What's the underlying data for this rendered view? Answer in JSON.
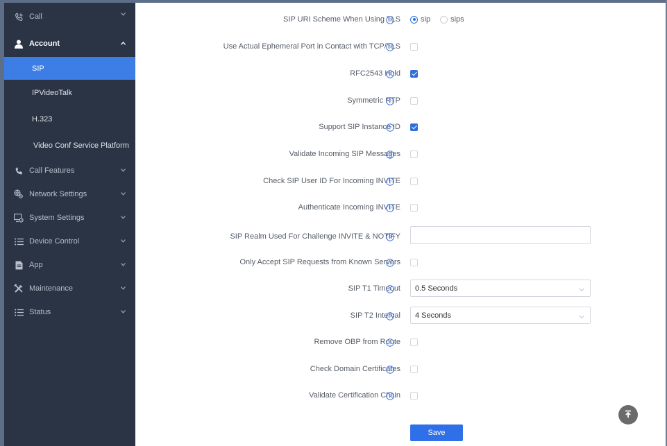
{
  "sidebar": {
    "call": {
      "label": "Call",
      "icon": "call-icon"
    },
    "account": {
      "label": "Account",
      "icon": "user-icon"
    },
    "account_subitems": [
      {
        "label": "SIP",
        "active": true
      },
      {
        "label": "IPVideoTalk",
        "active": false
      },
      {
        "label": "H.323",
        "active": false
      },
      {
        "label": "Video Conf Service Platform",
        "active": false
      }
    ],
    "items": [
      {
        "label": "Call Features",
        "icon": "phone-icon"
      },
      {
        "label": "Network Settings",
        "icon": "network-settings-icon"
      },
      {
        "label": "System Settings",
        "icon": "system-settings-icon"
      },
      {
        "label": "Device Control",
        "icon": "list-icon"
      },
      {
        "label": "App",
        "icon": "app-icon"
      },
      {
        "label": "Maintenance",
        "icon": "tools-icon"
      },
      {
        "label": "Status",
        "icon": "list-icon"
      }
    ]
  },
  "form": {
    "sip_uri_scheme": {
      "label": "SIP URI Scheme When Using TLS",
      "options": [
        "sip",
        "sips"
      ],
      "selected": "sip"
    },
    "ephemeral_port": {
      "label": "Use Actual Ephemeral Port in Contact with TCP/TLS",
      "checked": false
    },
    "rfc2543_hold": {
      "label": "RFC2543 Hold",
      "checked": true
    },
    "symmetric_rtp": {
      "label": "Symmetric RTP",
      "checked": false
    },
    "sip_instance_id": {
      "label": "Support SIP Instance ID",
      "checked": true
    },
    "validate_incoming": {
      "label": "Validate Incoming SIP Messages",
      "checked": false
    },
    "check_user_id": {
      "label": "Check SIP User ID For Incoming INVITE",
      "checked": false
    },
    "auth_invite": {
      "label": "Authenticate Incoming INVITE",
      "checked": false
    },
    "sip_realm": {
      "label": "SIP Realm Used For Challenge INVITE & NOTIFY",
      "value": ""
    },
    "known_servers": {
      "label": "Only Accept SIP Requests from Known Servers",
      "checked": false
    },
    "t1_timeout": {
      "label": "SIP T1 Timeout",
      "value": "0.5 Seconds"
    },
    "t2_interval": {
      "label": "SIP T2 Interval",
      "value": "4 Seconds"
    },
    "remove_obp": {
      "label": "Remove OBP from Route",
      "checked": false
    },
    "check_domain_certs": {
      "label": "Check Domain Certificates",
      "checked": false
    },
    "validate_cert_chain": {
      "label": "Validate Certification Chain",
      "checked": false
    }
  },
  "actions": {
    "save_label": "Save"
  },
  "colors": {
    "sidebar_bg": "#2b3445",
    "active_bg": "#3c7de6",
    "accent": "#2f6fdc",
    "help_icon": "#3a6fd8"
  }
}
